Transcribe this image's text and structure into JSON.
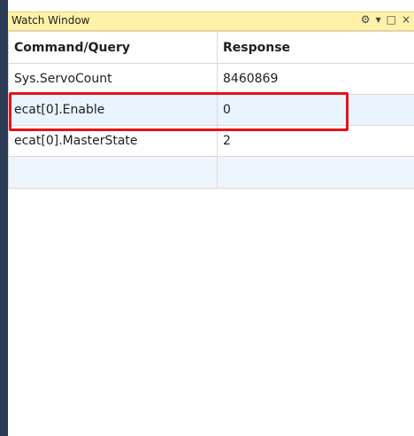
{
  "window": {
    "title": "Watch Window"
  },
  "title_icons": {
    "settings": "⚙",
    "dropdown": "▾",
    "maximize": "□",
    "close": "×"
  },
  "table": {
    "headers": [
      "Command/Query",
      "Response"
    ],
    "rows": [
      {
        "command": "Sys.ServoCount",
        "response": "8460869"
      },
      {
        "command": "ecat[0].Enable",
        "response": "0"
      },
      {
        "command": "ecat[0].MasterState",
        "response": "2"
      },
      {
        "command": "",
        "response": ""
      }
    ]
  },
  "colors": {
    "title_bar": "#fff2a8",
    "left_border": "#2b3a55",
    "highlight": "#e8101a",
    "selected_row": "#eaf4ff"
  }
}
